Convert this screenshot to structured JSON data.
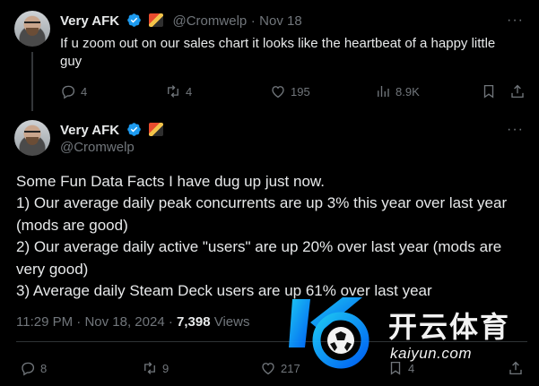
{
  "thread": {
    "reply": {
      "display_name": "Very AFK",
      "handle": "@Cromwelp",
      "separator": "·",
      "date": "Nov 18",
      "text": "If u zoom out on our sales chart it looks like the heartbeat of a happy little guy",
      "stats": {
        "replies": "4",
        "reposts": "4",
        "likes": "195",
        "views": "8.9K"
      }
    },
    "main": {
      "display_name": "Very AFK",
      "handle": "@Cromwelp",
      "body_lines": [
        "Some Fun Data Facts I have dug up just now.",
        "1) Our average daily peak concurrents are up 3% this year over last year (mods are good)",
        "2) Our average daily active \"users\" are up 20% over last year (mods are very good)",
        "3) Average daily Steam Deck users are up 61% over last year"
      ],
      "time": "11:29 PM",
      "separator": "·",
      "date": "Nov 18, 2024",
      "view_count": "7,398",
      "views_label": "Views",
      "stats": {
        "replies": "8",
        "reposts": "9",
        "likes": "217",
        "bookmarks": "4"
      }
    }
  },
  "watermark": {
    "brand": "开云体育",
    "url": "kaiyun.com"
  },
  "colors": {
    "background": "#000000",
    "text": "#e7e9ea",
    "muted": "#71767b",
    "verified": "#1d9bf0",
    "divider": "#2f3336"
  },
  "icons": [
    "verified-badge-icon",
    "affiliate-flag-icon",
    "more-icon",
    "reply-icon",
    "repost-icon",
    "like-icon",
    "views-icon",
    "bookmark-icon",
    "share-icon"
  ]
}
